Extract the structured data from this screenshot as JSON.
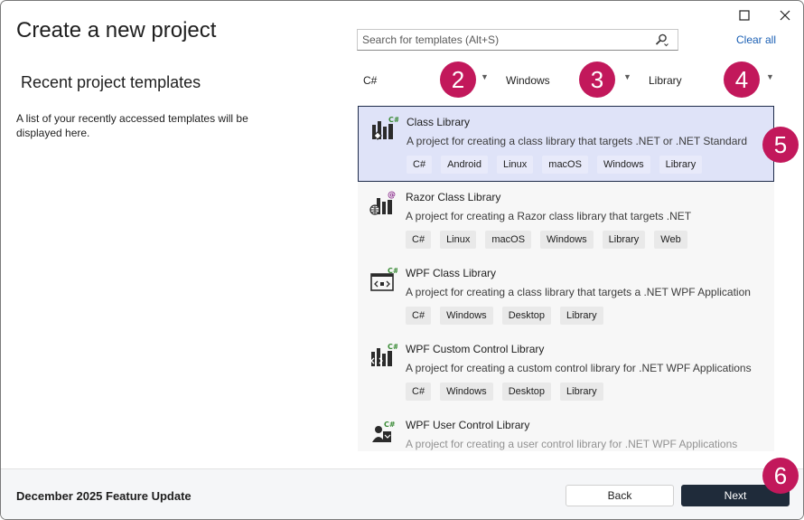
{
  "header": {
    "title": "Create a new project",
    "maximize_icon": "maximize-icon",
    "close_icon": "close-icon"
  },
  "left_panel": {
    "heading": "Recent project templates",
    "description": "A list of your recently accessed templates will be displayed here."
  },
  "search": {
    "placeholder": "Search for templates (Alt+S)",
    "value": "",
    "icon": "search-icon",
    "clear_all_label": "Clear all"
  },
  "filters": {
    "language": "C#",
    "platform": "Windows",
    "project_type": "Library"
  },
  "callouts": [
    "2",
    "3",
    "4",
    "5",
    "6"
  ],
  "colors": {
    "callout": "#c2185b",
    "selected_background": "#dfe3f8",
    "selected_border": "#1e2b4a",
    "primary_button": "#1f2b3a",
    "link": "#1a5fb4"
  },
  "templates": [
    {
      "name": "Class Library",
      "description": "A project for creating a class library that targets .NET or .NET Standard",
      "tags": [
        "C#",
        "Android",
        "Linux",
        "macOS",
        "Windows",
        "Library"
      ],
      "icon": "class-library-icon",
      "selected": true
    },
    {
      "name": "Razor Class Library",
      "description": "A project for creating a Razor class library that targets .NET",
      "tags": [
        "C#",
        "Linux",
        "macOS",
        "Windows",
        "Library",
        "Web"
      ],
      "icon": "razor-class-library-icon",
      "selected": false
    },
    {
      "name": "WPF Class Library",
      "description": "A project for creating a class library that targets a .NET WPF Application",
      "tags": [
        "C#",
        "Windows",
        "Desktop",
        "Library"
      ],
      "icon": "wpf-class-library-icon",
      "selected": false
    },
    {
      "name": "WPF Custom Control Library",
      "description": "A project for creating a custom control library for .NET WPF Applications",
      "tags": [
        "C#",
        "Windows",
        "Desktop",
        "Library"
      ],
      "icon": "wpf-custom-control-library-icon",
      "selected": false
    },
    {
      "name": "WPF User Control Library",
      "description": "A project for creating a user control library for .NET WPF Applications",
      "tags": [],
      "icon": "wpf-user-control-library-icon",
      "selected": false
    }
  ],
  "footer": {
    "label": "December 2025 Feature Update",
    "back_label": "Back",
    "next_label": "Next"
  }
}
